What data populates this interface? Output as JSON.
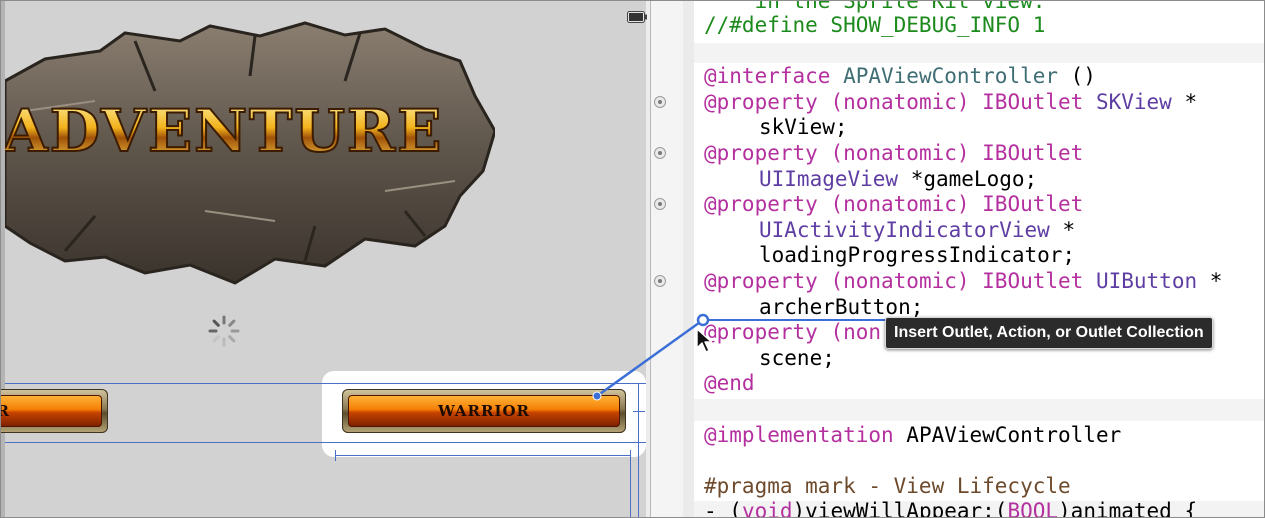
{
  "storyboard": {
    "logo_text": "ADVENTURE",
    "buttons": {
      "archer_partial_label": "R",
      "warrior_label": "WARRIOR"
    }
  },
  "editor": {
    "lines": {
      "l0": "    in the Sprite Kit view.",
      "l1": "//#define SHOW_DEBUG_INFO 1",
      "l3a": "@interface",
      "l3b": " APAViewController",
      "l3c": " ()",
      "prop": "@property",
      "nonatomic": " (nonatomic)",
      "iboutlet": " IBOutlet",
      "skview": " SKView",
      "star": " *",
      "skview_name": "skView;",
      "uiimageview": "UIImageView",
      "gamelogo": " *gameLogo;",
      "uiactivity": "UIActivityIndicatorView",
      "loading": "loadingProgressIndicator;",
      "uibutton": " UIButton",
      "archer": "archerButton;",
      "prop_partial": "@property",
      "paren_partial": " (non",
      "scene": "scene;",
      "end": "@end",
      "impl_kw": "@implementation",
      "impl_name": " APAViewController",
      "pragma": "#pragma mark - View Lifecycle",
      "last_a": "- (",
      "last_void": "void",
      "last_b": ")viewWillAppear:(",
      "last_bool": "BOOL",
      "last_c": ")animated {"
    }
  },
  "tooltip": {
    "text": "Insert Outlet, Action, or Outlet Collection"
  },
  "colors": {
    "keyword": "#b4309f",
    "class": "#5e3ea3",
    "comment": "#1c8a1c",
    "connection": "#3b6fd6"
  }
}
